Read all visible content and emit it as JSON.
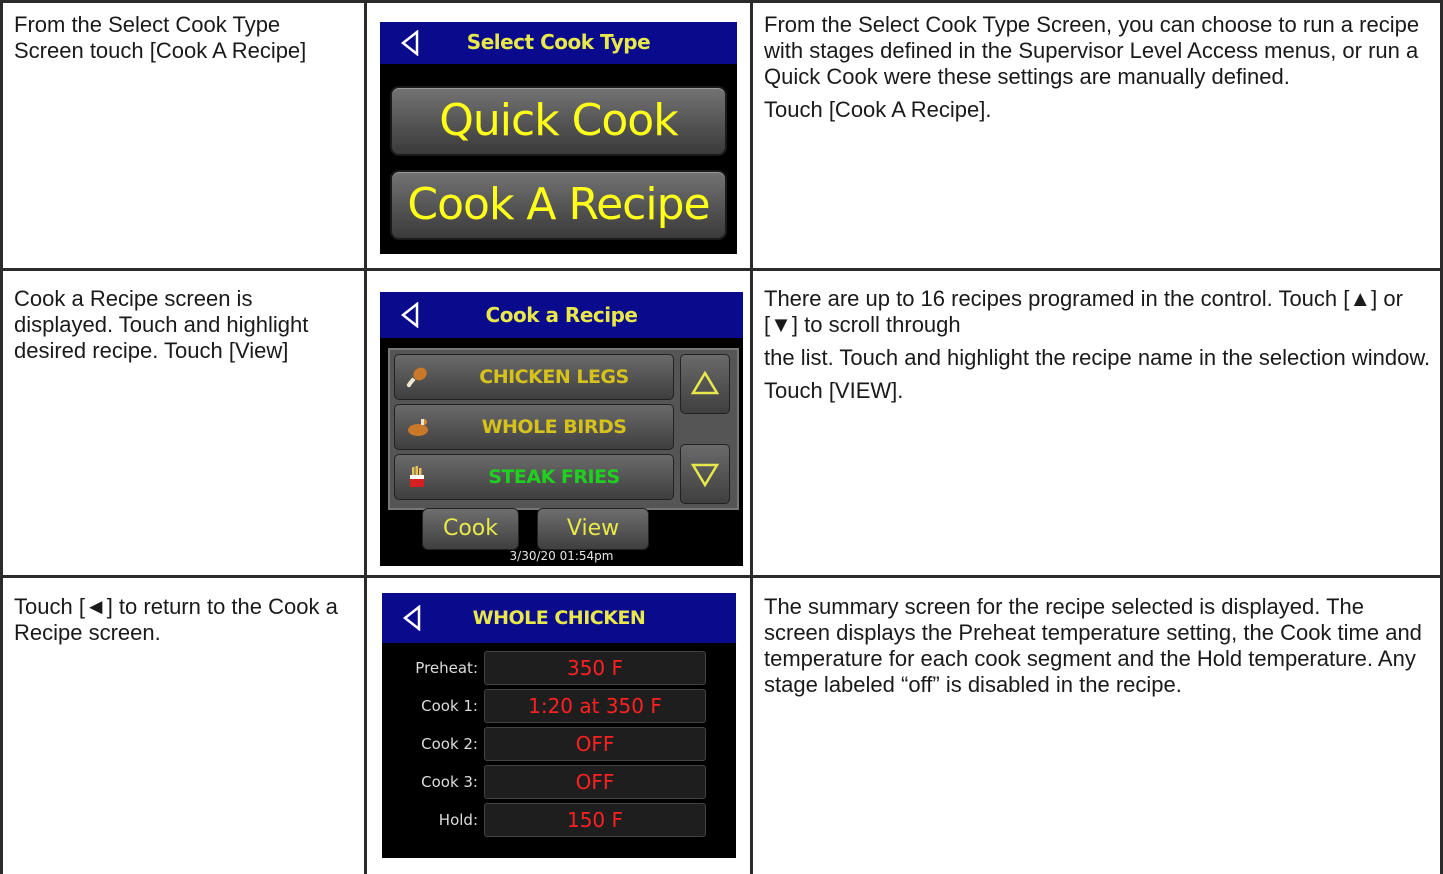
{
  "rows": [
    {
      "left_text": "From the Select Cook Type Screen touch [Cook A Recipe]",
      "right_paragraphs": [
        "From the Select Cook Type Screen, you can choose to run a recipe with stages defined in the Supervisor Level Access menus, or run a Quick Cook were these settings are manually defined.",
        "Touch [Cook A Recipe]."
      ]
    },
    {
      "left_text": "Cook a Recipe screen is displayed. Touch and highlight desired recipe. Touch [View]",
      "right_paragraphs": [
        "There are up to 16 recipes programed in the control. Touch [▲] or [▼] to scroll through",
        "the list. Touch and highlight the recipe name in the selection window.",
        "Touch [VIEW]."
      ]
    },
    {
      "left_text": "Touch [◄] to return to the Cook a Recipe screen.",
      "right_paragraphs": [
        "The summary screen for the recipe selected is displayed. The screen displays the Preheat temperature setting, the Cook time and temperature for each cook segment and the Hold temperature. Any stage labeled “off” is disabled in the recipe."
      ]
    }
  ],
  "screen1": {
    "title": "Select Cook Type",
    "btn_quick": "Quick Cook",
    "btn_recipe": "Cook A Recipe"
  },
  "screen2": {
    "title": "Cook a Recipe",
    "recipes": [
      {
        "name": "CHICKEN LEGS",
        "color": "#d6c21a",
        "icon": "drumstick-icon"
      },
      {
        "name": "WHOLE BIRDS",
        "color": "#d6c21a",
        "icon": "roast-chicken-icon"
      },
      {
        "name": "STEAK FRIES",
        "color": "#1fd11f",
        "icon": "fries-icon"
      }
    ],
    "btn_cook": "Cook",
    "btn_view": "View",
    "timestamp": "3/30/20 01:54pm"
  },
  "screen3": {
    "title": "WHOLE CHICKEN",
    "stages": [
      {
        "label": "Preheat:",
        "value": "350 F"
      },
      {
        "label": "Cook 1:",
        "value": "1:20 at 350 F"
      },
      {
        "label": "Cook 2:",
        "value": "OFF"
      },
      {
        "label": "Cook 3:",
        "value": "OFF"
      },
      {
        "label": "Hold:",
        "value": "150 F"
      }
    ]
  },
  "colors": {
    "titlebar": "#0a0a8c",
    "title_text": "#e8e84a",
    "button_text": "#ffff1a",
    "value_text": "#ff2020"
  }
}
